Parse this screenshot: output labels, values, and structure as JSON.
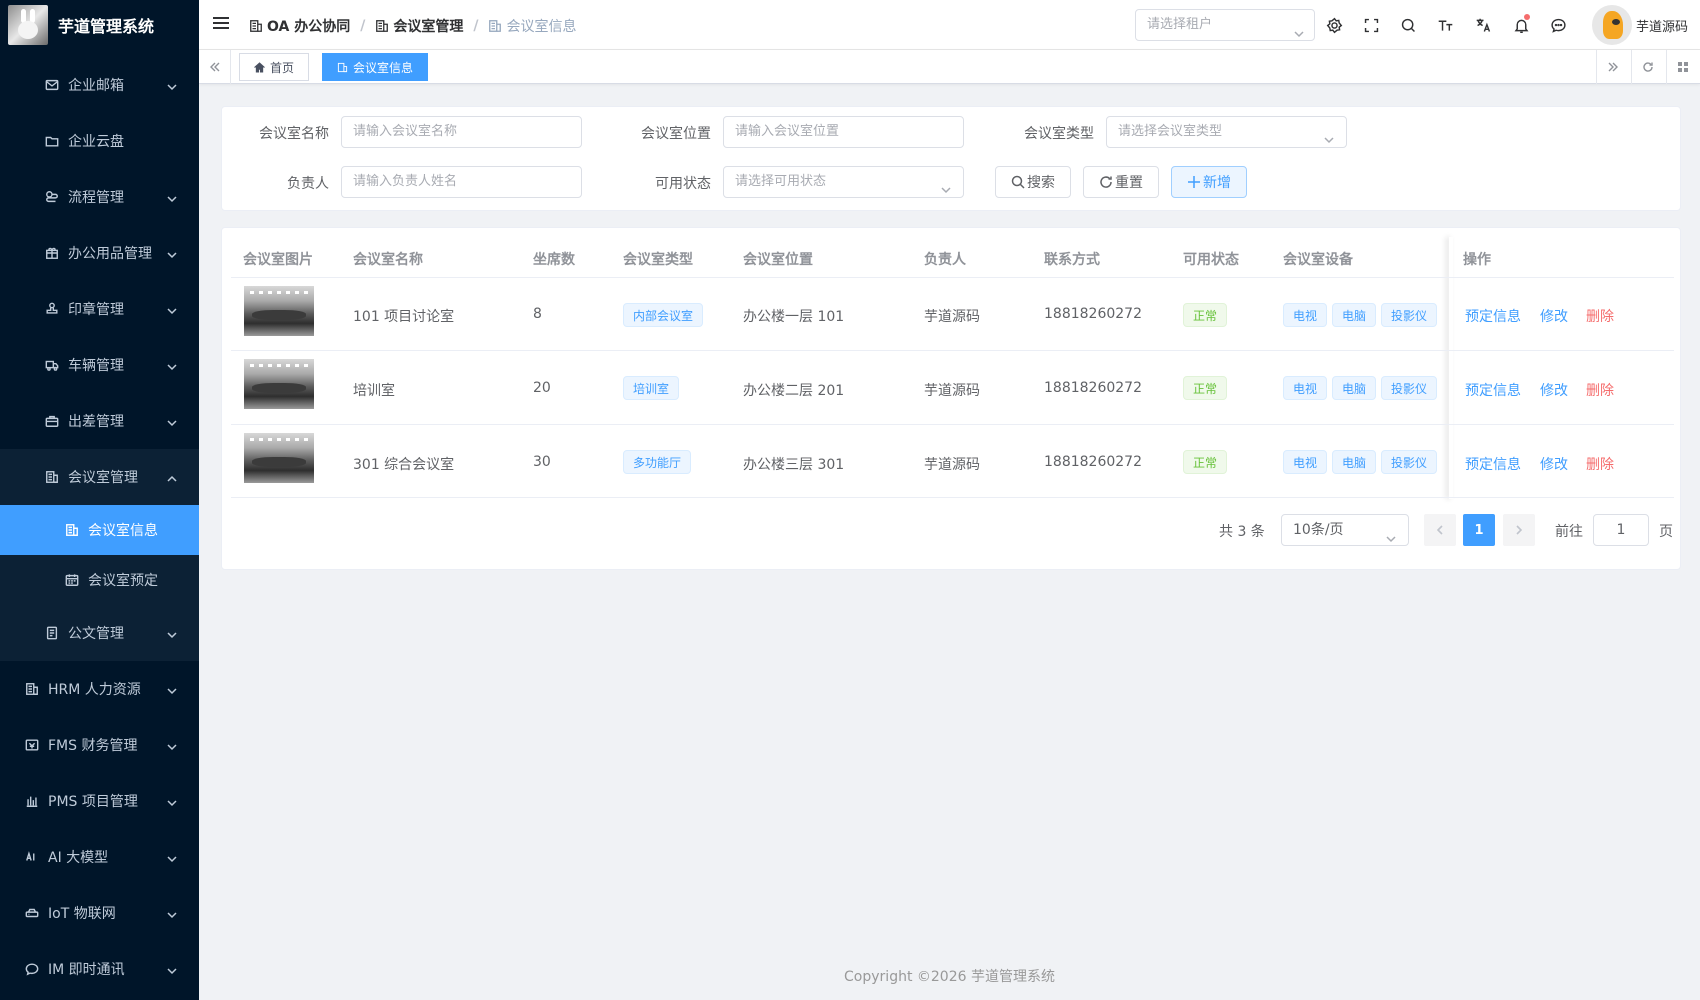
{
  "app": {
    "title": "芋道管理系统"
  },
  "sidebar": {
    "items": [
      {
        "label": "企业邮箱",
        "icon": "mail-icon",
        "expandable": true
      },
      {
        "label": "企业云盘",
        "icon": "folder-icon",
        "expandable": false
      },
      {
        "label": "流程管理",
        "icon": "flow-icon",
        "expandable": true
      },
      {
        "label": "办公用品管理",
        "icon": "gift-icon",
        "expandable": true
      },
      {
        "label": "印章管理",
        "icon": "stamp-icon",
        "expandable": true
      },
      {
        "label": "车辆管理",
        "icon": "truck-icon",
        "expandable": true
      },
      {
        "label": "出差管理",
        "icon": "briefcase-icon",
        "expandable": true
      },
      {
        "label": "会议室管理",
        "icon": "building-icon",
        "expandable": true,
        "open": true
      },
      {
        "label": "会议室信息",
        "icon": "building-icon",
        "active": true
      },
      {
        "label": "会议室预定",
        "icon": "calendar-icon"
      },
      {
        "label": "公文管理",
        "icon": "document-icon",
        "expandable": true
      },
      {
        "label": "HRM 人力资源",
        "icon": "building-icon",
        "expandable": true
      },
      {
        "label": "FMS 财务管理",
        "icon": "finance-icon",
        "expandable": true
      },
      {
        "label": "PMS 项目管理",
        "icon": "chart-icon",
        "expandable": true
      },
      {
        "label": "AI 大模型",
        "icon": "ai-icon",
        "expandable": true
      },
      {
        "label": "IoT 物联网",
        "icon": "iot-icon",
        "expandable": true
      },
      {
        "label": "IM 即时通讯",
        "icon": "chat-icon",
        "expandable": true
      }
    ]
  },
  "navbar": {
    "breadcrumb": [
      "OA 办公协同",
      "会议室管理",
      "会议室信息"
    ],
    "tenant_placeholder": "请选择租户",
    "username": "芋道源码"
  },
  "tags": {
    "home": "首页",
    "current": "会议室信息"
  },
  "search": {
    "name_label": "会议室名称",
    "name_placeholder": "请输入会议室名称",
    "location_label": "会议室位置",
    "location_placeholder": "请输入会议室位置",
    "type_label": "会议室类型",
    "type_placeholder": "请选择会议室类型",
    "manager_label": "负责人",
    "manager_placeholder": "请输入负责人姓名",
    "status_label": "可用状态",
    "status_placeholder": "请选择可用状态",
    "search_btn": "搜索",
    "reset_btn": "重置",
    "add_btn": "新增"
  },
  "table": {
    "headers": [
      "会议室图片",
      "会议室名称",
      "坐席数",
      "会议室类型",
      "会议室位置",
      "负责人",
      "联系方式",
      "可用状态",
      "会议室设备",
      "操作"
    ],
    "rows": [
      {
        "name": "101 项目讨论室",
        "seats": "8",
        "type": "内部会议室",
        "location": "办公楼一层 101",
        "manager": "芋道源码",
        "phone": "18818260272",
        "status": "正常",
        "devices": [
          "电视",
          "电脑",
          "投影仪"
        ]
      },
      {
        "name": "培训室",
        "seats": "20",
        "type": "培训室",
        "location": "办公楼二层 201",
        "manager": "芋道源码",
        "phone": "18818260272",
        "status": "正常",
        "devices": [
          "电视",
          "电脑",
          "投影仪"
        ]
      },
      {
        "name": "301 综合会议室",
        "seats": "30",
        "type": "多功能厅",
        "location": "办公楼三层 301",
        "manager": "芋道源码",
        "phone": "18818260272",
        "status": "正常",
        "devices": [
          "电视",
          "电脑",
          "投影仪"
        ]
      }
    ],
    "actions": {
      "reserve": "预定信息",
      "edit": "修改",
      "delete": "删除"
    }
  },
  "pagination": {
    "total": "共 3 条",
    "page_size": "10条/页",
    "current_page": "1",
    "goto_prefix": "前往",
    "goto_value": "1",
    "goto_suffix": "页"
  },
  "footer": "Copyright ©2026 芋道管理系统",
  "colors": {
    "primary": "#409eff",
    "sidebar_bg": "#001529",
    "danger": "#f56c6c",
    "success": "#67c23a"
  }
}
